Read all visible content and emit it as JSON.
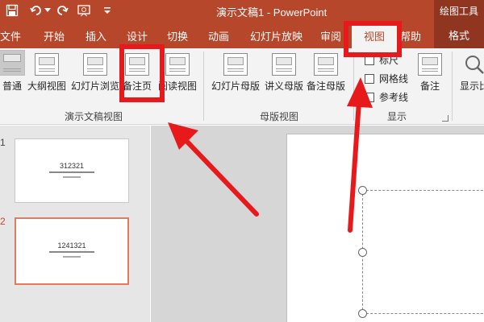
{
  "titlebar": {
    "title": "演示文稿1  -  PowerPoint",
    "contextual_tools": "绘图工具",
    "icons": [
      "save-icon",
      "undo-icon",
      "redo-icon",
      "slideshow-start-icon",
      "customize-toolbar-icon"
    ]
  },
  "tabs": {
    "file": "文件",
    "home": "开始",
    "insert": "插入",
    "design": "设计",
    "transitions": "切换",
    "animations": "动画",
    "slideshow": "幻灯片放映",
    "review": "审阅",
    "view": "视图",
    "help": "帮助",
    "format": "格式"
  },
  "ribbon": {
    "presentation_views": {
      "normal": "普通",
      "outline": "大纲视图",
      "slide_sorter": "幻灯片浏览",
      "notes_page": "备注页",
      "reading_view": "阅读视图",
      "group_label": "演示文稿视图"
    },
    "master_views": {
      "slide_master": "幻灯片母版",
      "handout_master": "讲义母版",
      "notes_master": "备注母版",
      "group_label": "母版视图"
    },
    "show": {
      "ruler": "标尺",
      "gridlines": "网格线",
      "guides": "参考线",
      "notes": "备注",
      "group_label": "显示"
    },
    "zoom_partial": "显示比"
  },
  "slides_panel": {
    "slides": [
      {
        "number": "1",
        "title": "312321",
        "subtitle_line": "",
        "active": false
      },
      {
        "number": "2",
        "title": "1241321",
        "subtitle_line": "",
        "active": true
      }
    ]
  },
  "colors": {
    "brand": "#b7472a",
    "annotation": "#e8191b",
    "active_thumb_border": "#e27a5e"
  }
}
